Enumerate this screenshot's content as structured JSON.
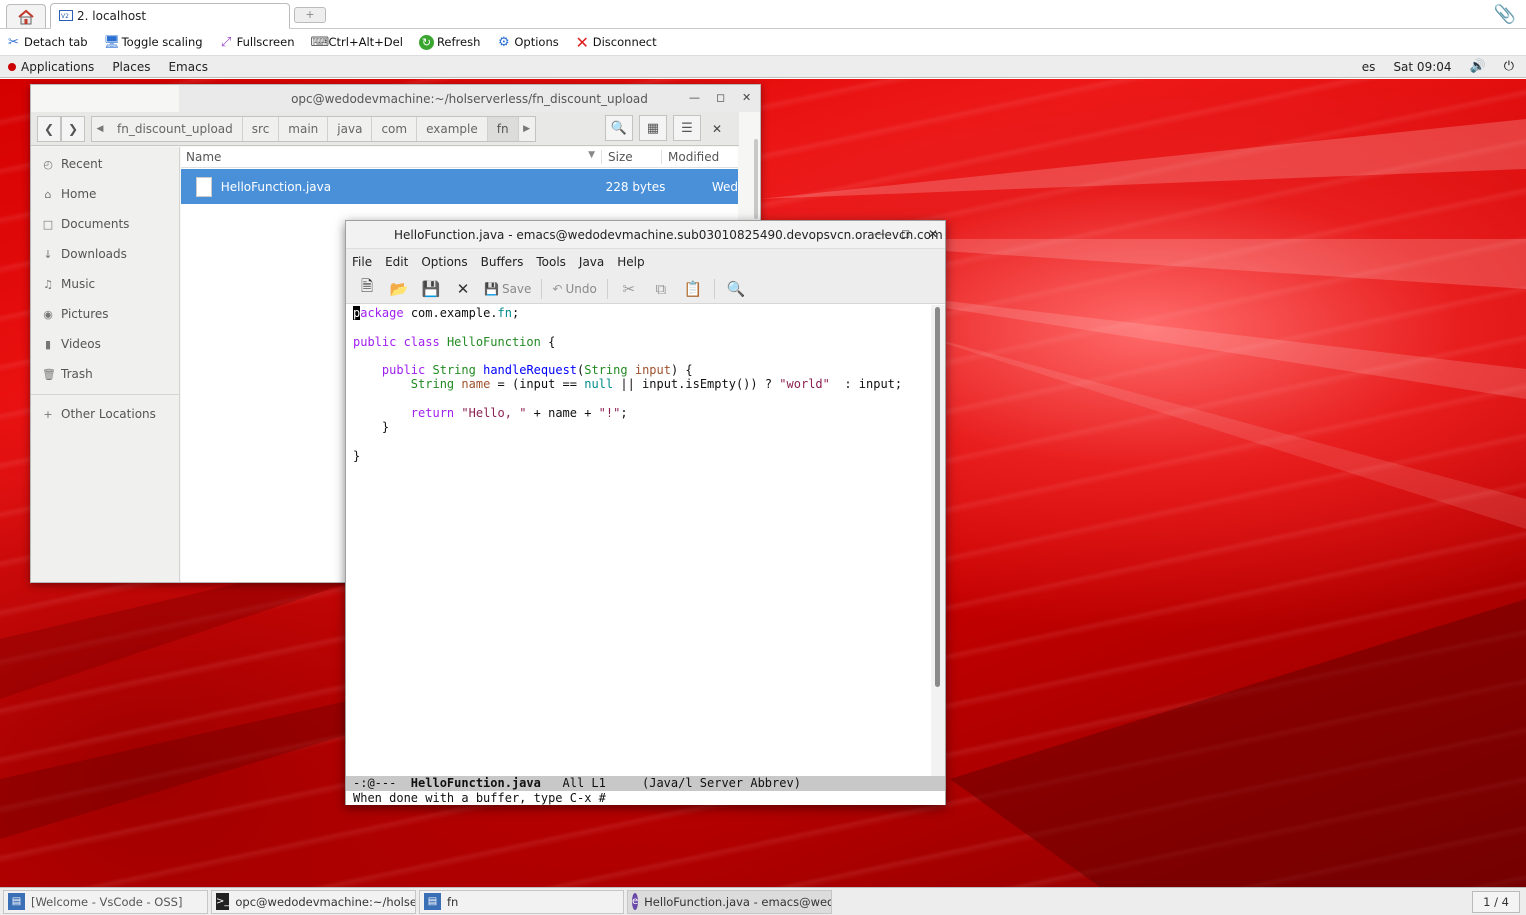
{
  "browser": {
    "tab_title": "2. localhost",
    "new_tab_symbol": "+"
  },
  "toolbar": {
    "items": [
      {
        "label": "Detach tab",
        "icon": "scissors-icon"
      },
      {
        "label": "Toggle scaling",
        "icon": "monitor-icon"
      },
      {
        "label": "Fullscreen",
        "icon": "fullscreen-icon"
      },
      {
        "label": "Ctrl+Alt+Del",
        "icon": "keyboard-icon"
      },
      {
        "label": "Refresh",
        "icon": "refresh-icon"
      },
      {
        "label": "Options",
        "icon": "gears-icon"
      },
      {
        "label": "Disconnect",
        "icon": "disconnect-icon"
      }
    ]
  },
  "panel": {
    "applications": "Applications",
    "places": "Places",
    "emacs": "Emacs",
    "keyboard_layout": "es",
    "clock": "Sat 09:04"
  },
  "files": {
    "title": "opc@wedodevmachine:~/holserverless/fn_discount_upload",
    "breadcrumbs": [
      "fn_discount_upload",
      "src",
      "main",
      "java",
      "com",
      "example",
      "fn"
    ],
    "sidebar": [
      "Recent",
      "Home",
      "Documents",
      "Downloads",
      "Music",
      "Pictures",
      "Videos",
      "Trash"
    ],
    "other_locations": "Other Locations",
    "columns": {
      "name": "Name",
      "size": "Size",
      "modified": "Modified"
    },
    "rows": [
      {
        "name": "HelloFunction.java",
        "size": "228 bytes",
        "modified": "Wed"
      }
    ]
  },
  "emacs": {
    "title": "HelloFunction.java - emacs@wedodevmachine.sub03010825490.devopsvcn.oraclevcn.com",
    "menu": [
      "File",
      "Edit",
      "Options",
      "Buffers",
      "Tools",
      "Java",
      "Help"
    ],
    "toolbar": {
      "save": "Save",
      "undo": "Undo"
    },
    "code": {
      "pkg_kw": "package",
      "pkg_name": " com.example.",
      "pkg_fn": "fn",
      "semicolon": ";",
      "class_line_kw": "public class",
      "class_name": "HelloFunction",
      "brace_open": " {",
      "m_public": "public",
      "m_string": "String",
      "m_name": "handleRequest",
      "m_paren": "(",
      "m_param_type": "String",
      "m_param": "input",
      "m_close": ") {",
      "v_type": "String",
      "v_name": "name",
      "v_expr1": " = (input == ",
      "v_null": "null",
      "v_expr2": " || input.isEmpty()) ? ",
      "v_world": "\"world\"",
      "v_expr3": "  : input;",
      "r_kw": "return",
      "r_str1": "\"Hello, \"",
      "r_mid": " + name + ",
      "r_str2": "\"!\"",
      "r_end": ";",
      "inner_close": "}",
      "outer_close": "}"
    },
    "modeline": "-:@---  HelloFunction.java   All L1     (Java/l Server Abbrev)",
    "modeline_prefix": "-:@---  ",
    "modeline_file": "HelloFunction.java",
    "modeline_rest": "   All L1     (Java/l Server Abbrev)",
    "minibuffer": "When done with a buffer, type C-x #"
  },
  "taskbar": {
    "tasks": [
      "[Welcome - VsCode - OSS]",
      "opc@wedodevmachine:~/holserverle...",
      "fn",
      "HelloFunction.java - emacs@wedod..."
    ],
    "workspace": "1 / 4"
  },
  "colors": {
    "selection": "#4a90d9",
    "desktop_red": "#e81d1d",
    "keyword": "#a020f0",
    "type": "#228b22",
    "function": "#0000ff",
    "variable": "#a0522d",
    "string": "#8b2252"
  }
}
